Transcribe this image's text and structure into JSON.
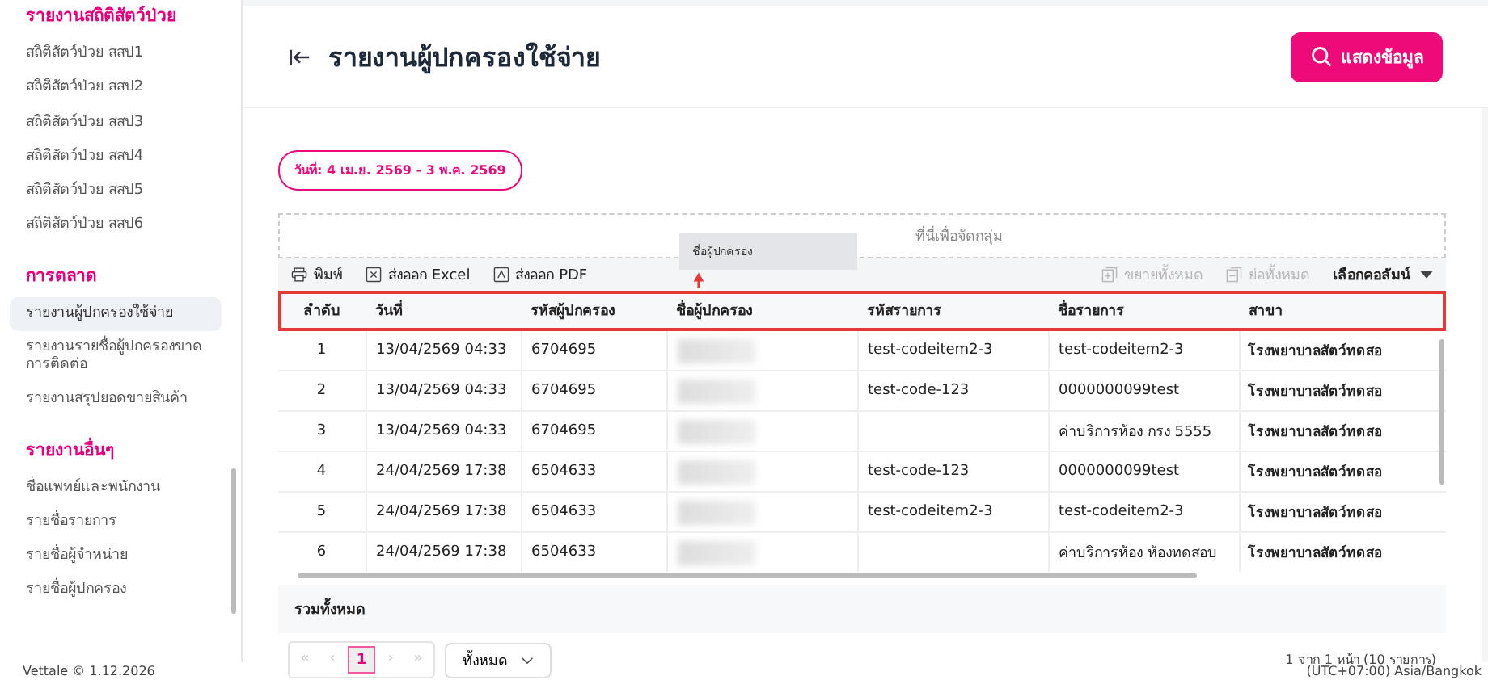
{
  "sidebar": {
    "sections": [
      {
        "title": "รายงานสถิติสัตว์ป่วย",
        "items": [
          {
            "label": "สถิติสัตว์ป่วย สสป1",
            "selected": false
          },
          {
            "label": "สถิติสัตว์ป่วย สสป2",
            "selected": false
          },
          {
            "label": "สถิติสัตว์ป่วย สสป3",
            "selected": false
          },
          {
            "label": "สถิติสัตว์ป่วย สสป4",
            "selected": false
          },
          {
            "label": "สถิติสัตว์ป่วย สสป5",
            "selected": false
          },
          {
            "label": "สถิติสัตว์ป่วย สสป6",
            "selected": false
          }
        ]
      },
      {
        "title": "การตลาด",
        "items": [
          {
            "label": "รายงานผู้ปกครองใช้จ่าย",
            "selected": true
          },
          {
            "label": "รายงานรายชื่อผู้ปกครองขาดการติดต่อ",
            "selected": false
          },
          {
            "label": "รายงานสรุปยอดขายสินค้า",
            "selected": false
          }
        ]
      },
      {
        "title": "รายงานอื่นๆ",
        "items": [
          {
            "label": "ชื่อแพทย์และพนักงาน",
            "selected": false
          },
          {
            "label": "รายชื่อรายการ",
            "selected": false
          },
          {
            "label": "รายชื่อผู้จำหน่าย",
            "selected": false
          },
          {
            "label": "รายชื่อผู้ปกครอง",
            "selected": false
          }
        ]
      }
    ]
  },
  "page": {
    "title": "รายงานผู้ปกครองใช้จ่าย",
    "show_button": "แสดงข้อมูล",
    "date_badge": "วันที่: 4 เม.ย. 2569 - 3 พ.ค. 2569"
  },
  "group_zone": {
    "hint": "ที่นี่เพื่อจัดกลุ่ม",
    "dragged_column": "ชื่อผู้ปกครอง"
  },
  "toolbar": {
    "left": [
      {
        "label": "พิมพ์",
        "kind": "print"
      },
      {
        "label": "ส่งออก Excel",
        "kind": "excel"
      },
      {
        "label": "ส่งออก PDF",
        "kind": "pdf"
      }
    ],
    "right": [
      {
        "label": "ขยายทั้งหมด",
        "kind": "expand",
        "disabled": true
      },
      {
        "label": "ย่อทั้งหมด",
        "kind": "collapse",
        "disabled": true
      }
    ],
    "column_chooser": "เลือกคอลัมน์"
  },
  "table": {
    "highlighted_header": true,
    "columns": [
      "ลำดับ",
      "วันที่",
      "รหัสผู้ปกครอง",
      "ชื่อผู้ปกครอง",
      "รหัสรายการ",
      "ชื่อรายการ",
      "สาขา"
    ],
    "rows": [
      [
        "1",
        "13/04/2569 04:33",
        "6704695",
        null,
        "test-codeitem2-3",
        "test-codeitem2-3",
        "โรงพยาบาลสัตว์ทดสอ"
      ],
      [
        "2",
        "13/04/2569 04:33",
        "6704695",
        null,
        "test-code-123",
        "0000000099test",
        "โรงพยาบาลสัตว์ทดสอ"
      ],
      [
        "3",
        "13/04/2569 04:33",
        "6704695",
        null,
        "",
        "ค่าบริการห้อง กรง 5555",
        "โรงพยาบาลสัตว์ทดสอ"
      ],
      [
        "4",
        "24/04/2569 17:38",
        "6504633",
        null,
        "test-code-123",
        "0000000099test",
        "โรงพยาบาลสัตว์ทดสอ"
      ],
      [
        "5",
        "24/04/2569 17:38",
        "6504633",
        null,
        "test-codeitem2-3",
        "test-codeitem2-3",
        "โรงพยาบาลสัตว์ทดสอ"
      ],
      [
        "6",
        "24/04/2569 17:38",
        "6504633",
        null,
        "",
        "ค่าบริการห้อง ห้องทดสอบ",
        "โรงพยาบาลสัตว์ทดสอ"
      ]
    ],
    "total_label": "รวมทั้งหมด"
  },
  "pagination": {
    "first": "«",
    "previous": "‹",
    "next": "›",
    "last": "»",
    "pages": [
      {
        "label": "1",
        "selected": true
      }
    ],
    "page_size": "ทั้งหมด",
    "summary": "1 จาก 1 หน้า (10 รายการ)"
  },
  "footer": {
    "left": "Vettale © 1.12.2026",
    "right": "(UTC+07:00) Asia/Bangkok"
  }
}
